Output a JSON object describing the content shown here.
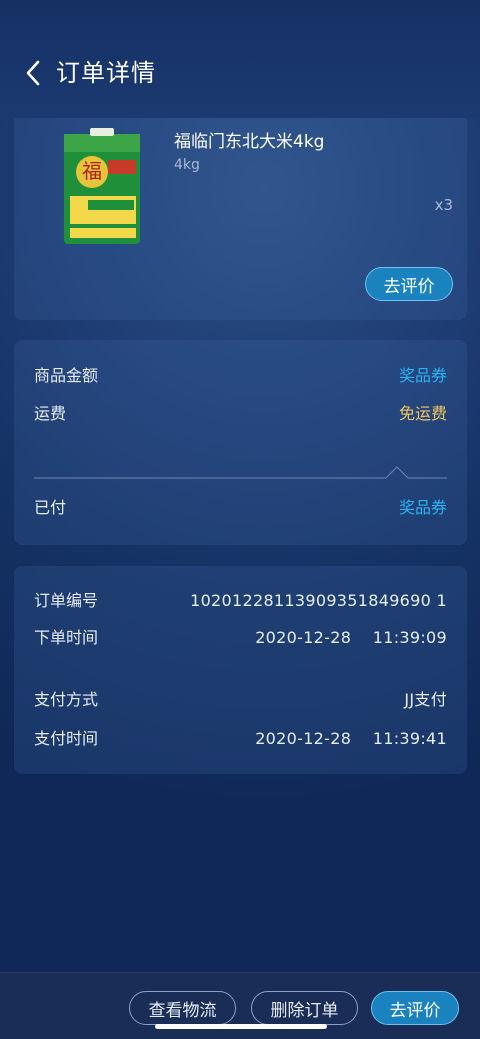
{
  "header": {
    "title": "订单详情"
  },
  "product": {
    "name": "福临门东北大米4kg",
    "spec": "4kg",
    "quantity": "x3",
    "review_label": "去评价"
  },
  "amounts": {
    "goods_label": "商品金额",
    "goods_value": "奖品券",
    "shipping_label": "运费",
    "shipping_value": "免运费",
    "paid_label": "已付",
    "paid_value": "奖品券"
  },
  "order_info": {
    "order_no_label": "订单编号",
    "order_no_value": "10201228113909351849690 1",
    "order_time_label": "下单时间",
    "order_time_value": "2020-12-28    11:39:09",
    "pay_method_label": "支付方式",
    "pay_method_value": "JJ支付",
    "pay_time_label": "支付时间",
    "pay_time_value": "2020-12-28    11:39:41"
  },
  "bottom_bar": {
    "logistics_label": "查看物流",
    "delete_label": "删除订单",
    "review_label": "去评价"
  },
  "colors": {
    "accent_blue": "#2ab3f2",
    "accent_gold": "#f1c45e",
    "button_fill": "#1a83bf"
  }
}
